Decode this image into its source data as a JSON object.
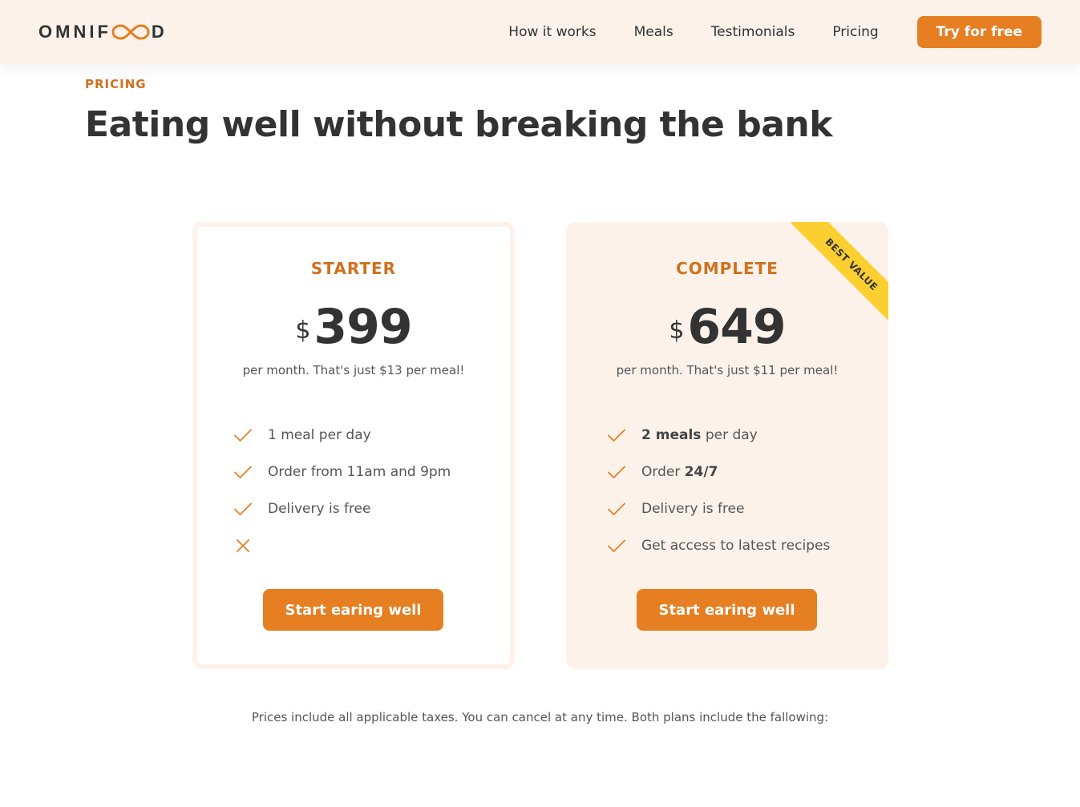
{
  "header": {
    "logo_left": "OMNIF",
    "logo_right": "D",
    "nav": [
      "How it works",
      "Meals",
      "Testimonials",
      "Pricing"
    ],
    "cta_label": "Try for free"
  },
  "section": {
    "subheading": "Pricing",
    "heading": "Eating well without breaking the bank"
  },
  "plans": {
    "starter": {
      "name": "STARTER",
      "currency": "$",
      "price": "399",
      "note": "per month. That's just $13 per meal!",
      "features": [
        {
          "bold": "",
          "text": "1 meal per day",
          "icon": "check-icon"
        },
        {
          "bold": "",
          "text": "Order from 11am and 9pm",
          "icon": "check-icon"
        },
        {
          "bold": "",
          "text": "Delivery is free",
          "icon": "check-icon"
        },
        {
          "bold": "",
          "text": "",
          "icon": "close-icon"
        }
      ],
      "button_label": "Start earing well"
    },
    "complete": {
      "name": "COMPLETE",
      "currency": "$",
      "price": "649",
      "note": "per month. That's just $11 per meal!",
      "ribbon": "BEST VALUE",
      "features": [
        {
          "bold": "2 meals",
          "text": " per day",
          "icon": "check-icon"
        },
        {
          "bold": "",
          "text": "Order ",
          "bold_after": "24/7",
          "icon": "check-icon"
        },
        {
          "bold": "",
          "text": "Delivery is free",
          "icon": "check-icon"
        },
        {
          "bold": "",
          "text": "Get access to latest recipes",
          "icon": "check-icon"
        }
      ],
      "button_label": "Start earing well"
    }
  },
  "footer_note": "Prices include all applicable taxes. You can cancel at any time. Both plans include the fallowing:",
  "colors": {
    "accent": "#e67e22",
    "accent_dark": "#cf711f",
    "tint": "#fdf2e9",
    "ribbon": "#fccf30",
    "text": "#333333"
  }
}
